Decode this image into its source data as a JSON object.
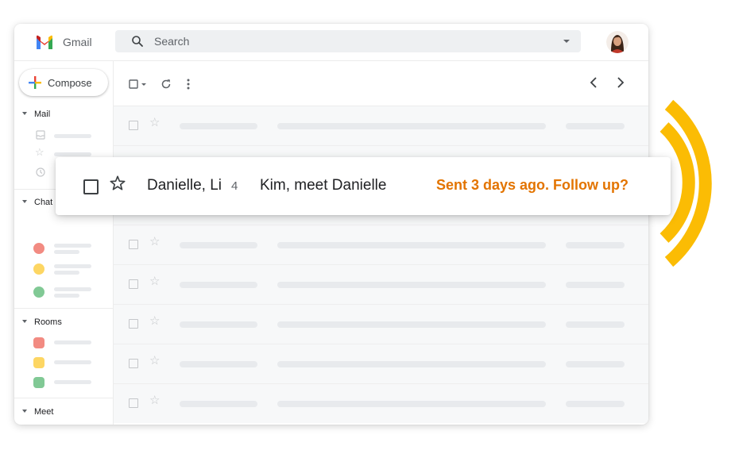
{
  "app": {
    "name": "Gmail"
  },
  "search": {
    "placeholder": "Search"
  },
  "compose": {
    "label": "Compose"
  },
  "sidebar": {
    "sections": [
      "Mail",
      "Chat",
      "Rooms",
      "Meet"
    ]
  },
  "highlight": {
    "sender": "Danielle, Li",
    "thread_count": "4",
    "subject": "Kim, meet Danielle",
    "nudge": "Sent 3 days ago. Follow up?"
  },
  "icons": [
    "gmail-logo",
    "search-icon",
    "dropdown-caret-icon",
    "avatar",
    "compose-plus-icon",
    "select-all-checkbox-icon",
    "refresh-icon",
    "more-vert-icon",
    "chevron-left-icon",
    "chevron-right-icon",
    "inbox-icon",
    "star-icon",
    "clock-icon",
    "video-icon",
    "checkbox-icon"
  ],
  "colors": {
    "nudge_orange": "#e37400",
    "arc_yellow": "#fbbc04",
    "chat_red": "#f28b82",
    "chat_yellow": "#fdd663",
    "chat_green": "#81c995"
  }
}
